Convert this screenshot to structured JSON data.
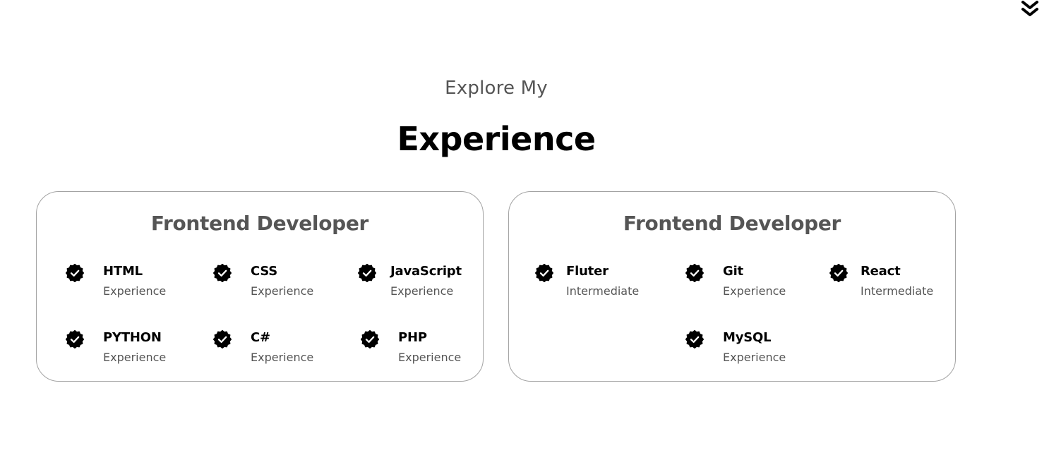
{
  "header": {
    "subtitle": "Explore My",
    "title": "Experience"
  },
  "nav": {
    "scroll_icon": "double-chevron-down-icon"
  },
  "cards": [
    {
      "title": "Frontend Developer",
      "skills": [
        {
          "name": "HTML",
          "level": "Experience"
        },
        {
          "name": "CSS",
          "level": "Experience"
        },
        {
          "name": "JavaScript",
          "level": "Experience"
        },
        {
          "name": "PYTHON",
          "level": "Experience"
        },
        {
          "name": "C#",
          "level": "Experience"
        },
        {
          "name": "PHP",
          "level": "Experience"
        }
      ]
    },
    {
      "title": "Frontend Developer",
      "skills": [
        {
          "name": "Fluter",
          "level": "Intermediate"
        },
        {
          "name": "Git",
          "level": "Experience"
        },
        {
          "name": "React",
          "level": "Intermediate"
        },
        {
          "name": "MySQL",
          "level": "Experience"
        }
      ]
    }
  ],
  "icons": {
    "skill_badge": "verified-check-badge-icon"
  },
  "colors": {
    "text_primary": "#000000",
    "text_muted": "#555555",
    "card_border": "#a3a3a3",
    "background": "#ffffff"
  }
}
